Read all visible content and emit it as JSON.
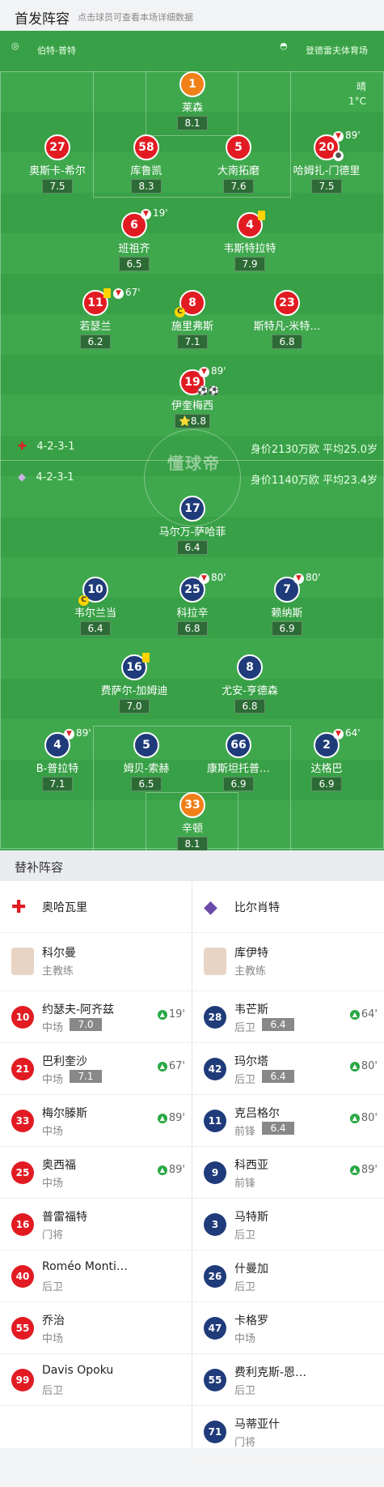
{
  "header": {
    "title": "首发阵容",
    "subtitle": "点击球员可查看本场详细数据"
  },
  "pitch": {
    "referee": "伯特-普特",
    "stadium": "登德雷夫体育场",
    "weather": "晴",
    "temperature": "1°C",
    "watermark": "懂球帝",
    "home_formation": "4-2-3-1",
    "home_value": "身价2130万欧 平均25.0岁",
    "away_formation": "4-2-3-1",
    "away_value": "身价1140万欧 平均23.4岁",
    "home_players": [
      {
        "num": "1",
        "name": "莱森",
        "rating": "8.1"
      },
      {
        "num": "27",
        "name": "奥斯卡-希尔",
        "rating": "7.5"
      },
      {
        "num": "58",
        "name": "库鲁凯",
        "rating": "8.3"
      },
      {
        "num": "5",
        "name": "大南拓磨",
        "rating": "7.6"
      },
      {
        "num": "20",
        "name": "哈姆扎-门德里",
        "rating": "7.5",
        "sub_min": "89'"
      },
      {
        "num": "6",
        "name": "班祖齐",
        "rating": "6.5",
        "sub_min": "19'"
      },
      {
        "num": "4",
        "name": "韦斯特拉特",
        "rating": "7.9"
      },
      {
        "num": "11",
        "name": "若瑟兰",
        "rating": "6.2",
        "sub_min": "67'"
      },
      {
        "num": "8",
        "name": "施里弗斯",
        "rating": "7.1"
      },
      {
        "num": "23",
        "name": "斯特凡-米特…",
        "rating": "6.8"
      },
      {
        "num": "19",
        "name": "伊奎梅西",
        "rating": "8.8",
        "sub_min": "89'"
      }
    ],
    "away_players": [
      {
        "num": "17",
        "name": "马尔万-萨哈菲",
        "rating": "6.4"
      },
      {
        "num": "10",
        "name": "韦尔兰当",
        "rating": "6.4"
      },
      {
        "num": "25",
        "name": "科拉辛",
        "rating": "6.8",
        "sub_min": "80'"
      },
      {
        "num": "7",
        "name": "赖纳斯",
        "rating": "6.9",
        "sub_min": "80'"
      },
      {
        "num": "16",
        "name": "费萨尔-加姆迪",
        "rating": "7.0"
      },
      {
        "num": "8",
        "name": "尤安-亨德森",
        "rating": "6.8"
      },
      {
        "num": "4",
        "name": "B-普拉特",
        "rating": "7.1",
        "sub_min": "89'"
      },
      {
        "num": "5",
        "name": "姆贝-索赫",
        "rating": "6.5"
      },
      {
        "num": "66",
        "name": "康斯坦托普…",
        "rating": "6.9"
      },
      {
        "num": "2",
        "name": "达格巴",
        "rating": "6.9",
        "sub_min": "64'"
      },
      {
        "num": "33",
        "name": "辛顿",
        "rating": "8.1"
      }
    ]
  },
  "subs": {
    "title": "替补阵容",
    "home_team": "奥哈瓦里",
    "away_team": "比尔肖特",
    "home_coach": {
      "name": "科尔曼",
      "role": "主教练"
    },
    "away_coach": {
      "name": "库伊特",
      "role": "主教练"
    },
    "home": [
      {
        "num": "10",
        "name": "约瑟夫-阿齐兹",
        "pos": "中场",
        "rating": "7.0",
        "min": "19'"
      },
      {
        "num": "21",
        "name": "巴利奎沙",
        "pos": "中场",
        "rating": "7.1",
        "min": "67'"
      },
      {
        "num": "33",
        "name": "梅尔滕斯",
        "pos": "中场",
        "rating": "",
        "min": "89'"
      },
      {
        "num": "25",
        "name": "奥西福",
        "pos": "中场",
        "rating": "",
        "min": "89'"
      },
      {
        "num": "16",
        "name": "普雷福特",
        "pos": "门将",
        "rating": "",
        "min": ""
      },
      {
        "num": "40",
        "name": "Roméo Monti…",
        "pos": "后卫",
        "rating": "",
        "min": ""
      },
      {
        "num": "55",
        "name": "乔治",
        "pos": "中场",
        "rating": "",
        "min": ""
      },
      {
        "num": "99",
        "name": "Davis Opoku",
        "pos": "后卫",
        "rating": "",
        "min": ""
      }
    ],
    "away": [
      {
        "num": "28",
        "name": "韦芒斯",
        "pos": "后卫",
        "rating": "6.4",
        "min": "64'"
      },
      {
        "num": "42",
        "name": "玛尔塔",
        "pos": "后卫",
        "rating": "6.4",
        "min": "80'"
      },
      {
        "num": "11",
        "name": "克吕格尔",
        "pos": "前锋",
        "rating": "6.4",
        "min": "80'"
      },
      {
        "num": "9",
        "name": "科西亚",
        "pos": "前锋",
        "rating": "",
        "min": "89'"
      },
      {
        "num": "3",
        "name": "马特斯",
        "pos": "后卫",
        "rating": "",
        "min": ""
      },
      {
        "num": "26",
        "name": "什曼加",
        "pos": "后卫",
        "rating": "",
        "min": ""
      },
      {
        "num": "47",
        "name": "卡格罗",
        "pos": "中场",
        "rating": "",
        "min": ""
      },
      {
        "num": "55",
        "name": "费利克斯-恩…",
        "pos": "后卫",
        "rating": "",
        "min": ""
      },
      {
        "num": "71",
        "name": "马蒂亚什",
        "pos": "门将",
        "rating": "",
        "min": ""
      }
    ]
  },
  "colors": {
    "home": "#e21b23",
    "away": "#1f3b7a",
    "pitch": "#3fa84d"
  }
}
